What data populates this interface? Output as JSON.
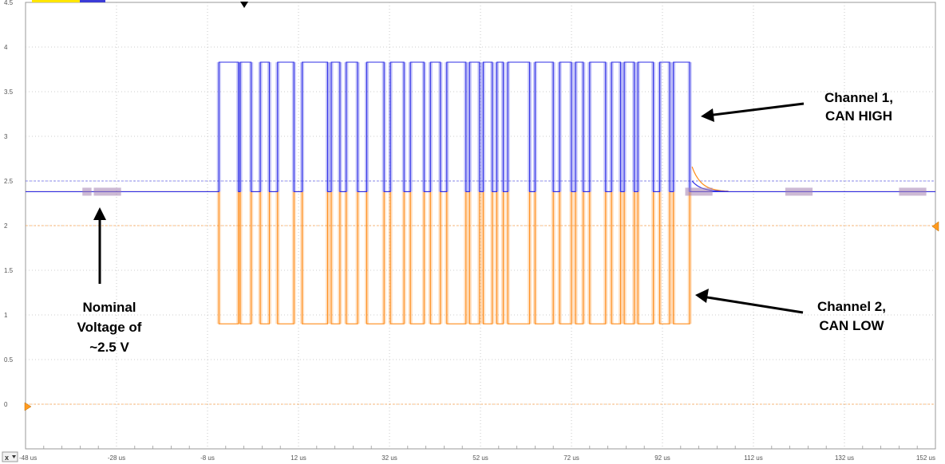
{
  "chart_data": {
    "type": "line",
    "title": "",
    "xlabel": "",
    "ylabel": "",
    "x_unit": "us",
    "xlim": [
      -48,
      152
    ],
    "ylim": [
      -0.5,
      4.5
    ],
    "x_ticks": [
      "-48 us",
      "-28 us",
      "-8 us",
      "12 us",
      "32 us",
      "52 us",
      "72 us",
      "92 us",
      "112 us",
      "132 us",
      "152 us"
    ],
    "y_ticks": [
      "0",
      "0.5",
      "1",
      "1.5",
      "2",
      "2.5",
      "3",
      "3.5",
      "4",
      "4.5"
    ],
    "grid": true,
    "colors": {
      "ch1": "#2e2ee6",
      "ch2": "#ff8c1a",
      "grid": "#bcbcbc"
    },
    "reference_levels": [
      {
        "y": 2.5,
        "color": "#2e2ee6"
      },
      {
        "y": 2.0,
        "color": "#ff8c1a"
      },
      {
        "y": 0.0,
        "color": "#ff8c1a"
      }
    ],
    "recessive_v": 2.38,
    "ch1_dominant_v": 3.83,
    "ch2_dominant_v": 0.9,
    "frame_start_us": -5.5,
    "frame_end_us": 98.5,
    "dominant_segments_us": [
      [
        -5.5,
        -1.2
      ],
      [
        -0.8,
        1.6
      ],
      [
        3.6,
        5.6
      ],
      [
        7.4,
        11.0
      ],
      [
        12.8,
        18.4
      ],
      [
        19.2,
        21.1
      ],
      [
        22.5,
        25.0
      ],
      [
        27.0,
        30.8
      ],
      [
        32.2,
        35.2
      ],
      [
        36.6,
        39.6
      ],
      [
        41.0,
        43.2
      ],
      [
        44.6,
        48.8
      ],
      [
        49.6,
        51.8
      ],
      [
        52.6,
        54.6
      ],
      [
        55.6,
        57.0
      ],
      [
        58.0,
        62.8
      ],
      [
        64.0,
        68.0
      ],
      [
        69.4,
        72.0
      ],
      [
        72.9,
        74.6
      ],
      [
        76.0,
        79.5
      ],
      [
        80.8,
        82.8
      ],
      [
        83.6,
        85.8
      ],
      [
        86.6,
        90.0
      ],
      [
        91.4,
        93.6
      ],
      [
        94.4,
        98.0
      ]
    ],
    "series": [
      {
        "name": "Channel 1, CAN HIGH"
      },
      {
        "name": "Channel 2, CAN LOW"
      }
    ],
    "annotations": {
      "ch1_label": [
        "Channel 1,",
        "CAN HIGH"
      ],
      "ch2_label": [
        "Channel 2,",
        "CAN LOW"
      ],
      "nominal_label": [
        "Nominal",
        "Voltage of",
        "~2.5 V"
      ]
    }
  },
  "scope": {
    "x_button_label": "x",
    "x_dropdown_icon": "chevron-down-icon",
    "trigger_marker_icon": "triangle-down-icon"
  }
}
